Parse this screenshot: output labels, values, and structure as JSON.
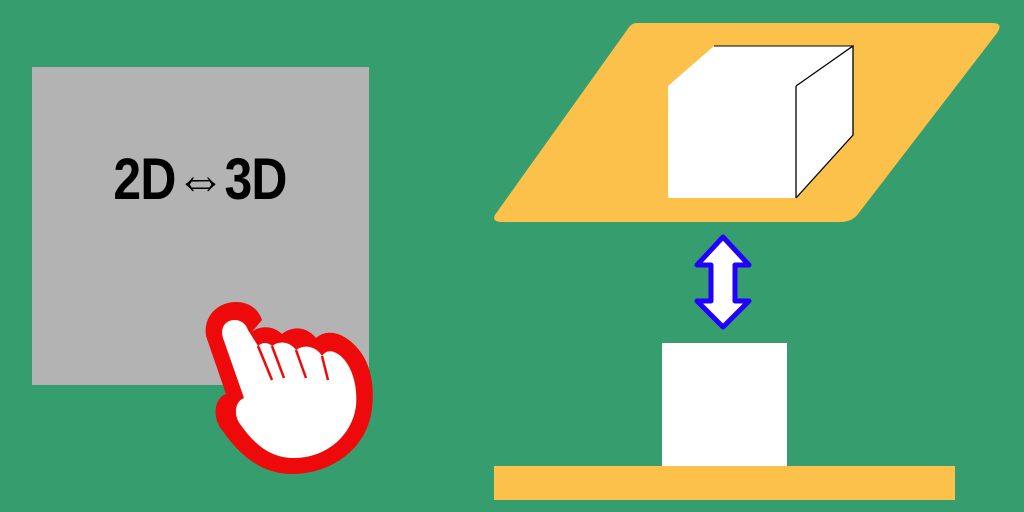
{
  "mode_toggle": {
    "label": "2D⇔3D"
  },
  "colors": {
    "background": "#369e6e",
    "panel": "#b3b3b3",
    "platform": "#fcc14a",
    "cube": "#ffffff",
    "arrow_fill": "#ffffff",
    "arrow_stroke": "#2200ff",
    "hand_outline": "#ee0a0a"
  },
  "icons": {
    "pointer": "pointing-hand-icon",
    "transition": "double-vertical-arrow-icon",
    "cube_3d": "cube-3d-icon",
    "square_2d": "square-2d-icon"
  }
}
